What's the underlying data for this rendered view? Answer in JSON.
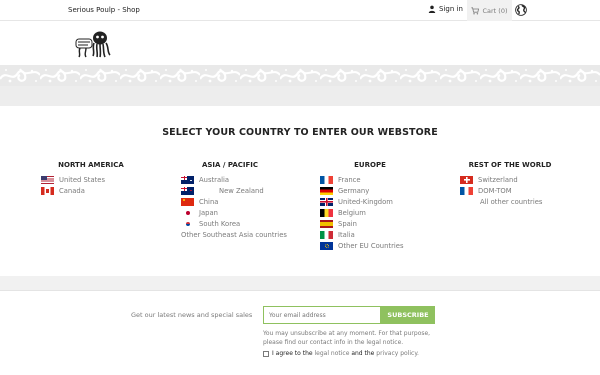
{
  "topbar": {
    "shop_name": "Serious Poulp - Shop",
    "signin_label": "Sign in",
    "cart_label": "Cart (0)"
  },
  "main": {
    "title": "SELECT YOUR COUNTRY TO ENTER OUR WEBSTORE"
  },
  "regions": {
    "north_america": {
      "heading": "NORTH AMERICA",
      "countries": [
        "United States",
        "Canada"
      ]
    },
    "asia_pacific": {
      "heading": "ASIA / PACIFIC",
      "countries": [
        "Australia",
        "New Zealand",
        "China",
        "Japan",
        "South Korea",
        "Other Southeast Asia countries"
      ]
    },
    "europe": {
      "heading": "EUROPE",
      "countries": [
        "France",
        "Germany",
        "United-Kingdom",
        "Belgium",
        "Spain",
        "Italia",
        "Other EU Countries"
      ]
    },
    "rest_of_world": {
      "heading": "REST OF THE WORLD",
      "countries": [
        "Switzerland",
        "DOM-TOM",
        "All other countries"
      ]
    }
  },
  "newsletter": {
    "label": "Get our latest news and special sales",
    "input_placeholder": "Your email address",
    "button_label": "SUBSCRIBE",
    "note": "You may unsubscribe at any moment. For that purpose, please find our contact info in the legal notice.",
    "agree_prefix": "I agree to the",
    "legal_link": "legal notice",
    "agree_and": "and the",
    "privacy_link": "privacy policy."
  },
  "colors": {
    "accent": "#8fc15f",
    "text_dark": "#232323",
    "text_muted": "#7a7a7a"
  }
}
